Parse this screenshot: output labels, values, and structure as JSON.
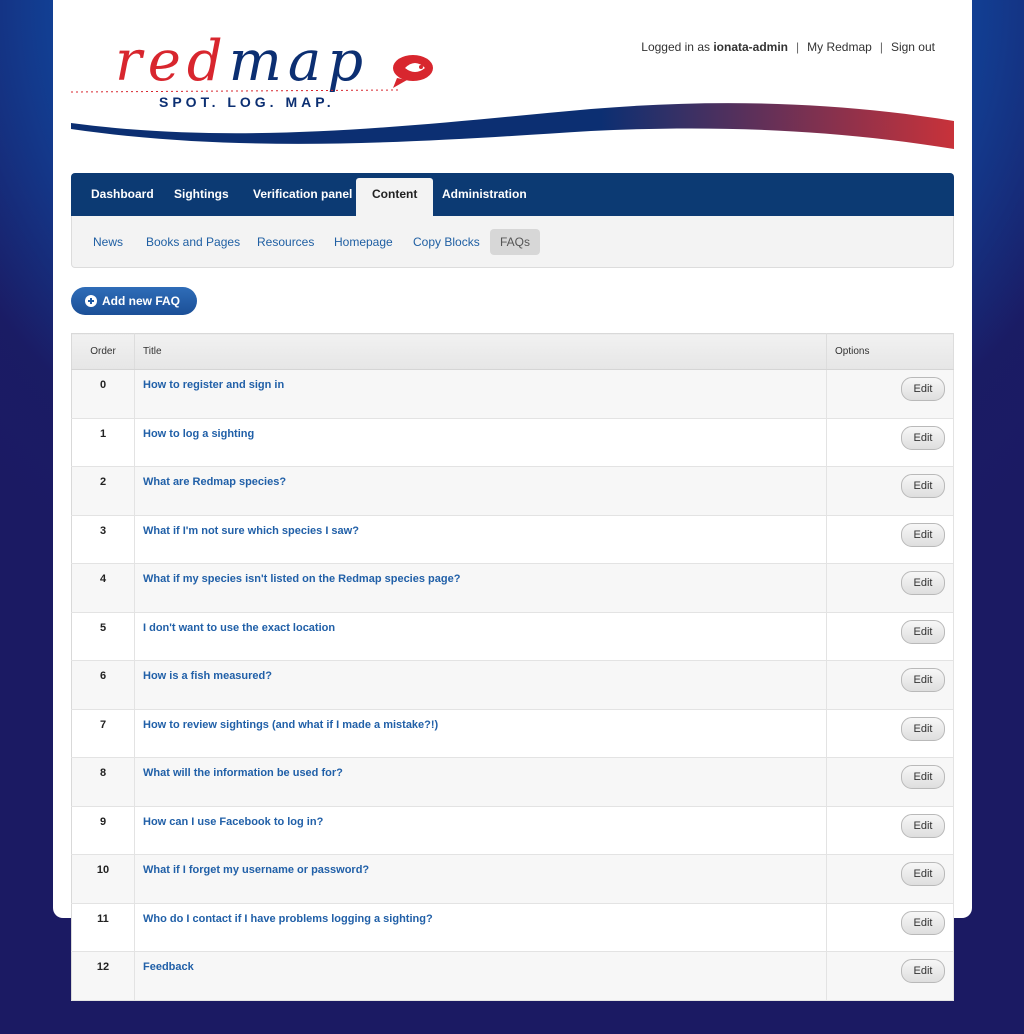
{
  "header": {
    "logo_word_red": "red",
    "logo_word_blue": "map",
    "logo_tagline": "SPOT. LOG. MAP.",
    "user_prefix": "Logged in as",
    "username": "ionata-admin",
    "my_redmap": "My Redmap",
    "sign_out": "Sign out"
  },
  "primary_nav": [
    {
      "label": "Dashboard",
      "active": false
    },
    {
      "label": "Sightings",
      "active": false
    },
    {
      "label": "Verification panel",
      "active": false
    },
    {
      "label": "Content",
      "active": true
    },
    {
      "label": "Administration",
      "active": false
    }
  ],
  "sub_nav": [
    {
      "label": "News",
      "active": false
    },
    {
      "label": "Books and Pages",
      "active": false
    },
    {
      "label": "Resources",
      "active": false
    },
    {
      "label": "Homepage",
      "active": false
    },
    {
      "label": "Copy Blocks",
      "active": false
    },
    {
      "label": "FAQs",
      "active": true
    }
  ],
  "add_button": "Add new FAQ",
  "table": {
    "columns": {
      "order": "Order",
      "title": "Title",
      "options": "Options"
    },
    "edit_label": "Edit",
    "rows": [
      {
        "order": "0",
        "title": "How to register and sign in"
      },
      {
        "order": "1",
        "title": "How to log a sighting"
      },
      {
        "order": "2",
        "title": "What are Redmap species?"
      },
      {
        "order": "3",
        "title": "What if I'm not sure which species I saw?"
      },
      {
        "order": "4",
        "title": "What if my species isn't listed on the Redmap species page?"
      },
      {
        "order": "5",
        "title": "I don't want to use the exact location"
      },
      {
        "order": "6",
        "title": "How is a fish measured?"
      },
      {
        "order": "7",
        "title": "How to review sightings (and what if I made a mistake?!)"
      },
      {
        "order": "8",
        "title": "What will the information be used for?"
      },
      {
        "order": "9",
        "title": "How can I use Facebook to log in?"
      },
      {
        "order": "10",
        "title": "What if I forget my username or password?"
      },
      {
        "order": "11",
        "title": "Who do I contact if I have problems logging a sighting?"
      },
      {
        "order": "12",
        "title": "Feedback"
      }
    ]
  },
  "colors": {
    "brand_blue": "#0c3a73",
    "brand_red": "#d8262e",
    "link_blue": "#2160a8"
  }
}
